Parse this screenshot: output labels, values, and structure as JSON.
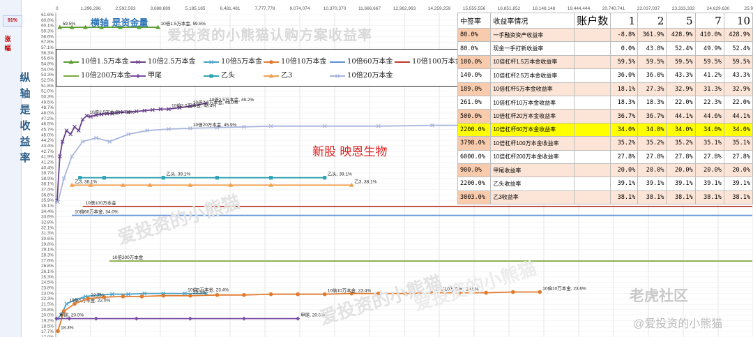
{
  "sidebar": {
    "tag_pct": "91%",
    "tag_updown": "涨幅"
  },
  "chart_title": "爱投资的小熊猫认购方案收益率",
  "x_axis_title": "横轴 是资金量",
  "y_axis_title": "纵轴是收益率",
  "stock_name": "新股 映恩生物",
  "watermarks": [
    "爱投资的小熊猫",
    "爱投资的小熊猫",
    "爱投资的小熊猫"
  ],
  "platform_mark": "老虎社区",
  "author_mark": "@爱投资的小熊猫",
  "colors": {
    "x_title": "#2e75b6",
    "y_title": "#2e5f8a",
    "stock": "#e02020",
    "highlight": "#ffff00",
    "header_pink": "#f8cbad"
  },
  "chart_data": {
    "type": "line",
    "x_ticks": [
      "0",
      "1,296,296",
      "2,592,593",
      "3,888,889",
      "5,185,185",
      "6,481,481",
      "7,777,778",
      "9,074,074",
      "10,370,370",
      "11,666,667",
      "12,962,963",
      "14,259,259",
      "15,555,556",
      "16,851,852",
      "18,148,148",
      "19,444,444",
      "20,740,741",
      "22,037,037",
      "23,333,333",
      "24,629,630",
      "25,925,9"
    ],
    "xlim": [
      0,
      25925926
    ],
    "ylim": [
      0.175,
      0.615
    ],
    "y_ticks_pct": [
      "61.6%",
      "60.8%",
      "60.1%",
      "59.3%",
      "58.6%",
      "57.8%",
      "57.1%",
      "56.3%",
      "55.6%",
      "54.8%",
      "54.0%",
      "53.3%",
      "52.5%",
      "51.8%",
      "51.0%",
      "50.3%",
      "49.5%",
      "48.7%",
      "48.0%",
      "47.2%",
      "46.5%",
      "45.7%",
      "45.0%",
      "44.2%",
      "43.4%",
      "42.7%",
      "41.9%",
      "41.2%",
      "40.4%",
      "39.7%",
      "38.9%",
      "38.1%",
      "37.4%",
      "36.6%",
      "35.9%",
      "35.1%",
      "34.4%",
      "33.6%",
      "32.8%",
      "32.1%",
      "31.3%",
      "30.6%",
      "29.8%",
      "29.1%",
      "28.3%",
      "27.6%",
      "26.8%",
      "26.1%",
      "25.3%",
      "24.5%",
      "23.8%",
      "23.0%",
      "22.3%",
      "21.5%",
      "20.8%",
      "20.0%",
      "19.2%",
      "18.5%",
      "17.7%",
      "17.0%"
    ],
    "grid": true,
    "legend_position": "top-left",
    "series": [
      {
        "name": "10倍1.5万本金",
        "color": "#5c9e31",
        "marker": "triangle",
        "x": [
          150000,
          600000,
          1100000,
          1700000,
          2400000,
          3100000,
          3800000
        ],
        "y": [
          0.595,
          0.595,
          0.595,
          0.595,
          0.595,
          0.595,
          0.595
        ],
        "labels": [
          {
            "i": 0,
            "text": "59.5%"
          },
          {
            "i": 6,
            "text": "10倍1.5万本金, 59.5%"
          }
        ]
      },
      {
        "name": "10倍2.5万本金",
        "color": "#6b3f8f",
        "marker": "x",
        "x": [
          50000,
          150000,
          250000,
          400000,
          550000,
          700000,
          850000,
          1000000,
          1150000,
          1300000,
          1500000,
          1700000,
          1900000,
          2100000,
          2400000,
          2700000,
          3000000,
          3300000,
          3600000,
          3900000,
          4200000,
          4600000,
          5000000,
          5600000
        ],
        "y": [
          0.36,
          0.42,
          0.44,
          0.455,
          0.45,
          0.46,
          0.455,
          0.47,
          0.475,
          0.474,
          0.476,
          0.477,
          0.478,
          0.478,
          0.48,
          0.48,
          0.481,
          0.482,
          0.483,
          0.484,
          0.484,
          0.486,
          0.488,
          0.492
        ],
        "labels": [
          {
            "i": 8,
            "text": "10倍2.5万本金, 47.0%"
          },
          {
            "i": 20,
            "text": "10倍2.5万本金, 48.4%"
          },
          {
            "i": 22,
            "text": "10倍2.5万本金, 49.0%"
          },
          {
            "i": 23,
            "text": "10倍2.5万本金, 49.2%"
          }
        ]
      },
      {
        "name": "10倍5万本金",
        "color": "#4aa3c6",
        "marker": "x",
        "x": [
          60000,
          200000,
          400000,
          700000,
          1100000,
          1600000,
          2100000,
          2700000,
          3300000,
          4000000,
          4800000,
          5600000
        ],
        "y": [
          0.2,
          0.205,
          0.22,
          0.225,
          0.23,
          0.232,
          0.233,
          0.233,
          0.234,
          0.234,
          0.234,
          0.234
        ],
        "labels": [
          {
            "i": 2,
            "text": "10倍5万本金, 22.0%"
          },
          {
            "i": 10,
            "text": "10倍5万本金, 23.4%"
          }
        ]
      },
      {
        "name": "10倍10万本金",
        "color": "#e07b2e",
        "marker": "circle",
        "x": [
          80000,
          300000,
          700000,
          1200000,
          1800000,
          2500000,
          3200000,
          4000000,
          5000000,
          6000000,
          7000000,
          8000000,
          9000000,
          10000000,
          11000000,
          12000000,
          13000000,
          14000000,
          15000000,
          16000000,
          17000000,
          18000000
        ],
        "y": [
          0.183,
          0.21,
          0.22,
          0.227,
          0.229,
          0.23,
          0.23,
          0.231,
          0.231,
          0.232,
          0.232,
          0.233,
          0.233,
          0.233,
          0.234,
          0.234,
          0.234,
          0.235,
          0.235,
          0.235,
          0.236,
          0.236
        ],
        "labels": [
          {
            "i": 0,
            "text": "18.3%"
          },
          {
            "i": 3,
            "text": "22.7%"
          },
          {
            "i": 8,
            "text": "23.3%"
          },
          {
            "i": 13,
            "text": "10倍10万本金, 23.4%"
          },
          {
            "i": 17,
            "text": "10倍10万本金, 23.5%"
          },
          {
            "i": 21,
            "text": "10倍10万本金, 23.6%"
          }
        ]
      },
      {
        "name": "10倍60万本金",
        "color": "#5b8fd6",
        "marker": "none",
        "x": [
          600000,
          25900000
        ],
        "y": [
          0.34,
          0.34
        ],
        "labels": [
          {
            "i": 0,
            "text": "10倍60万本金, 34.0%"
          }
        ]
      },
      {
        "name": "10倍100万本金",
        "color": "#c0392b",
        "marker": "none",
        "x": [
          1000000,
          25900000
        ],
        "y": [
          0.352,
          0.352
        ],
        "labels": [
          {
            "i": 0,
            "text": "10倍100万本金"
          }
        ]
      },
      {
        "name": "10倍200万本金",
        "color": "#7fa83a",
        "marker": "none",
        "x": [
          2000000,
          25900000
        ],
        "y": [
          0.278,
          0.278
        ],
        "labels": [
          {
            "i": 0,
            "text": "10倍200万本金"
          }
        ]
      },
      {
        "name": "甲尾",
        "color": "#7b4fa6",
        "marker": "diamond",
        "x": [
          30000,
          500000,
          1500000,
          3000000,
          5000000,
          7000000,
          9000000
        ],
        "y": [
          0.2,
          0.2,
          0.2,
          0.2,
          0.2,
          0.2,
          0.2
        ],
        "labels": [
          {
            "i": 0,
            "text": "甲尾, 20.0%"
          },
          {
            "i": 6,
            "text": "甲尾, 20.0%"
          }
        ]
      },
      {
        "name": "乙头",
        "color": "#2fa3b4",
        "marker": "square",
        "x": [
          900000,
          1800000,
          4000000,
          6000000,
          8000000,
          10000000
        ],
        "y": [
          0.391,
          0.391,
          0.391,
          0.391,
          0.391,
          0.391
        ],
        "labels": [
          {
            "i": 2,
            "text": "乙头, 39.1%"
          },
          {
            "i": 5,
            "text": "乙头, 39.1%"
          }
        ]
      },
      {
        "name": "乙3",
        "color": "#f0a050",
        "marker": "triangle",
        "x": [
          600000,
          1300000,
          2500000,
          3500000,
          5000000,
          6500000,
          8000000,
          11000000
        ],
        "y": [
          0.381,
          0.381,
          0.381,
          0.381,
          0.381,
          0.381,
          0.381,
          0.381
        ],
        "labels": [
          {
            "i": 0,
            "text": "乙3, 38.1%"
          },
          {
            "i": 7,
            "text": "乙3, 38.1%"
          }
        ]
      },
      {
        "name": "10倍20万本金",
        "color": "#a9b6dc",
        "marker": "x",
        "x": [
          80000,
          300000,
          600000,
          1000000,
          1500000,
          2000000,
          2700000,
          3400000,
          4200000,
          5000000,
          6000000,
          7000000,
          8000000,
          10000000,
          12000000,
          14000000,
          16000000
        ],
        "y": [
          0.358,
          0.39,
          0.42,
          0.44,
          0.445,
          0.44,
          0.45,
          0.455,
          0.457,
          0.458,
          0.459,
          0.46,
          0.461,
          0.461,
          0.461,
          0.462,
          0.462
        ],
        "labels": [
          {
            "i": 9,
            "text": "10倍20万本金, 45.9%"
          },
          {
            "i": 16,
            "text": "10倍20万"
          }
        ]
      }
    ]
  },
  "legend_items": [
    {
      "name": "10倍1.5万本金",
      "color": "#5c9e31",
      "marker": "triangle"
    },
    {
      "name": "10倍2.5万本金",
      "color": "#6b3f8f",
      "marker": "x"
    },
    {
      "name": "10倍5万本金",
      "color": "#4aa3c6",
      "marker": "x"
    },
    {
      "name": "10倍10万本金",
      "color": "#e07b2e",
      "marker": "circle"
    },
    {
      "name": "10倍60万本金",
      "color": "#5b8fd6",
      "marker": "none"
    },
    {
      "name": "10倍100万本金",
      "color": "#c0392b",
      "marker": "none"
    },
    {
      "name": "10倍200万本金",
      "color": "#7fa83a",
      "marker": "none"
    },
    {
      "name": "甲尾",
      "color": "#7b4fa6",
      "marker": "diamond"
    },
    {
      "name": "乙头",
      "color": "#2fa3b4",
      "marker": "square"
    },
    {
      "name": "乙3",
      "color": "#f0a050",
      "marker": "triangle"
    },
    {
      "name": "10倍20万本金",
      "color": "#a9b6dc",
      "marker": "x"
    }
  ],
  "rate_table": {
    "headers": [
      "中签率",
      "收益率情况",
      "账户数",
      "1",
      "2",
      "5",
      "7",
      "10"
    ],
    "rows": [
      {
        "rate": "80.0%",
        "label": "一手融资资产收益率",
        "v": [
          "-8.8%",
          "361.9%",
          "428.9%",
          "410.0%",
          "428.9%"
        ],
        "shade": "pk"
      },
      {
        "rate": "80.0%",
        "label": "现金一手打新收益率",
        "v": [
          "0.0%",
          "43.8%",
          "52.4%",
          "49.9%",
          "52.4%"
        ],
        "shade": ""
      },
      {
        "rate": "100.0%",
        "label": "10倍杠杆1.5万本金收益率",
        "v": [
          "59.5%",
          "59.5%",
          "59.5%",
          "59.5%",
          "59.5%"
        ],
        "shade": "pl"
      },
      {
        "rate": "140.0%",
        "label": "10倍杠杆2.5万本金收益率",
        "v": [
          "36.0%",
          "36.0%",
          "43.3%",
          "41.2%",
          "43.3%"
        ],
        "shade": ""
      },
      {
        "rate": "189.0%",
        "label": "10倍杠杆5万本金收益率",
        "v": [
          "18.1%",
          "27.3%",
          "32.9%",
          "31.3%",
          "32.9%"
        ],
        "shade": "pl"
      },
      {
        "rate": "261.0%",
        "label": "10倍杠杆10万本金收益率",
        "v": [
          "18.3%",
          "18.3%",
          "22.0%",
          "22.3%",
          "22.0%"
        ],
        "shade": ""
      },
      {
        "rate": "500.0%",
        "label": "10倍杠杆20万本金收益率",
        "v": [
          "36.7%",
          "36.7%",
          "44.1%",
          "44.6%",
          "44.1%"
        ],
        "shade": "pl"
      },
      {
        "rate": "2200.0%",
        "label": "10倍杠杆60万本金收益率",
        "v": [
          "34.0%",
          "34.0%",
          "34.0%",
          "34.0%",
          "34.0%"
        ],
        "shade": "hl"
      },
      {
        "rate": "3798.0%",
        "label": "10倍杠杆100万本金收益率",
        "v": [
          "35.2%",
          "35.2%",
          "35.2%",
          "35.1%",
          "35.1%"
        ],
        "shade": "pl"
      },
      {
        "rate": "6000.0%",
        "label": "10倍杠杆200万本金收益率",
        "v": [
          "27.8%",
          "27.8%",
          "27.8%",
          "27.8%",
          "27.8%"
        ],
        "shade": ""
      },
      {
        "rate": "900.0%",
        "label": "甲尾收益率",
        "v": [
          "20.0%",
          "20.0%",
          "20.0%",
          "20.0%",
          "20.0%"
        ],
        "shade": "pl"
      },
      {
        "rate": "2200.0%",
        "label": "乙头收益率",
        "v": [
          "39.1%",
          "39.1%",
          "39.1%",
          "39.1%",
          "39.1%"
        ],
        "shade": ""
      },
      {
        "rate": "3003.0%",
        "label": "乙3收益率",
        "v": [
          "38.1%",
          "38.1%",
          "38.1%",
          "38.1%",
          "38.1%"
        ],
        "shade": "pl"
      }
    ]
  }
}
